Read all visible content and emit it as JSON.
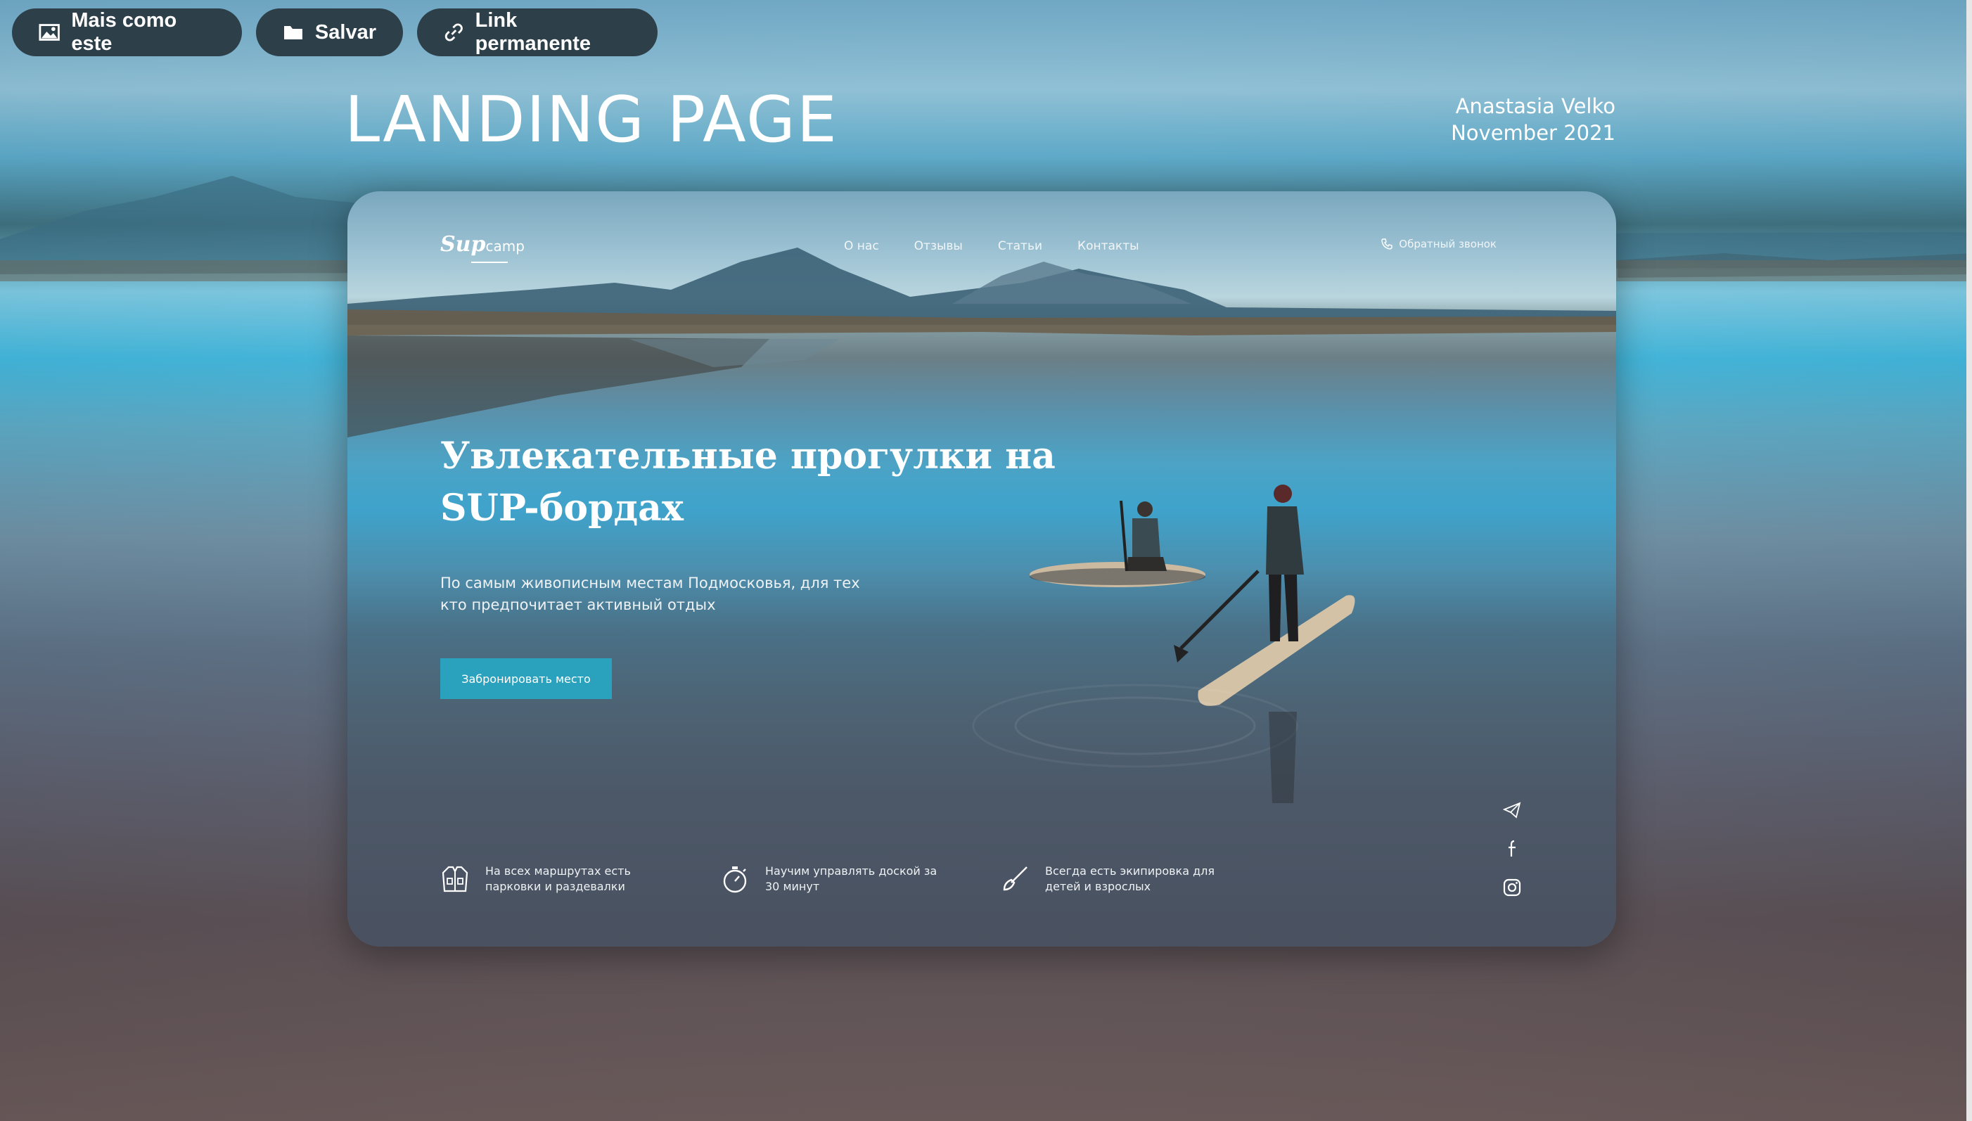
{
  "toolbar": {
    "more_like_this": "Mais como este",
    "save": "Salvar",
    "permalink": "Link permanente"
  },
  "presentation": {
    "title": "LANDING PAGE",
    "author": "Anastasia Velko",
    "date": "November 2021"
  },
  "site": {
    "logo_sup": "Sup",
    "logo_camp": "camp",
    "nav": [
      "О нас",
      "Отзывы",
      "Статьи",
      "Контакты"
    ],
    "callback": "Обратный звонок",
    "hero_title": "Увлекательные прогулки на SUP-бордах",
    "hero_subtitle": "По самым живописным местам Подмосковья, для тех кто предпочитает активный отдых",
    "cta": "Забронировать место",
    "features": [
      {
        "icon": "vest-icon",
        "text": "На всех маршрутах есть парковки и раздевалки"
      },
      {
        "icon": "stopwatch-icon",
        "text": "Научим управлять доской за 30 минут"
      },
      {
        "icon": "paddle-icon",
        "text": "Всегда есть экипировка для детей и взрослых"
      }
    ],
    "social": [
      "telegram-icon",
      "facebook-icon",
      "instagram-icon"
    ]
  },
  "colors": {
    "cta": "#2aa2bd",
    "toolbar_button": "#2d3f49"
  }
}
